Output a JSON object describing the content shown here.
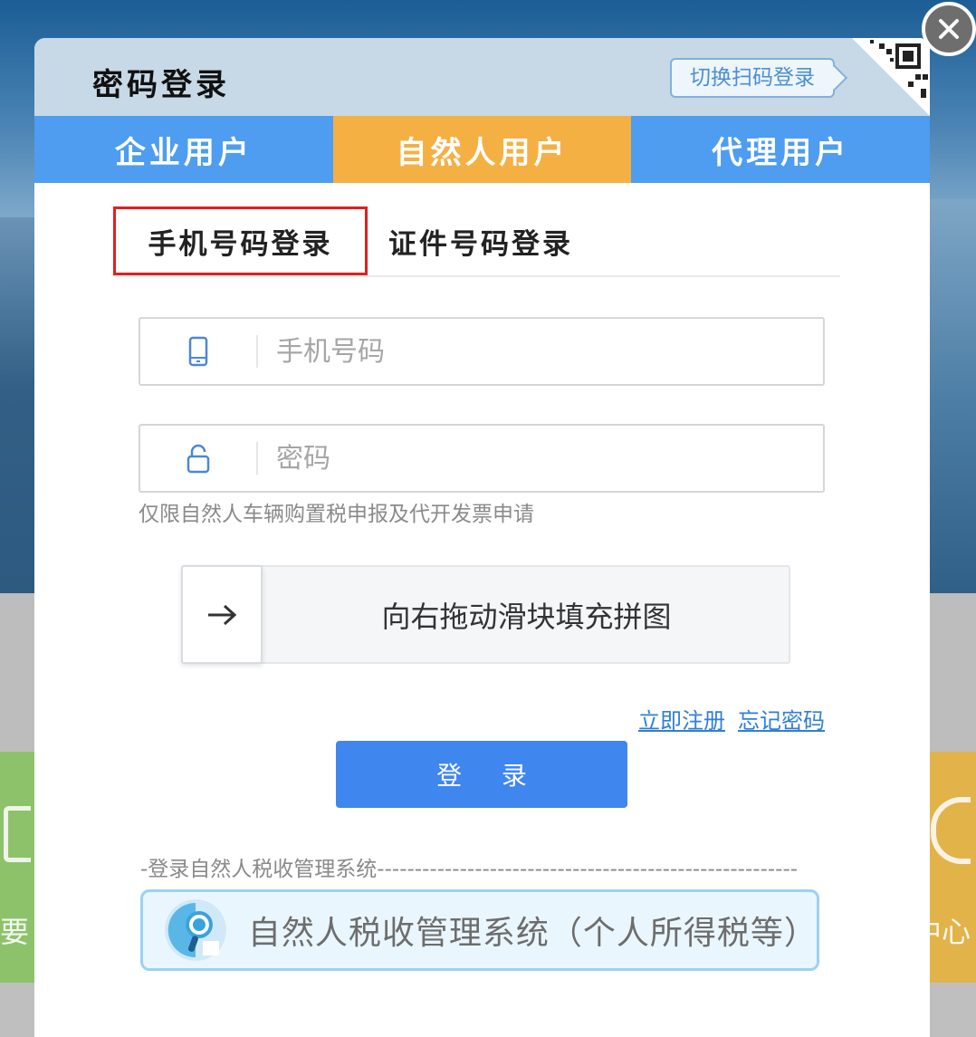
{
  "dialog": {
    "title": "密码登录",
    "switch_qr_label": "切换扫码登录"
  },
  "user_tabs": [
    {
      "label": "企业用户",
      "active": false
    },
    {
      "label": "自然人用户",
      "active": true
    },
    {
      "label": "代理用户",
      "active": false
    }
  ],
  "login_tabs": [
    {
      "label": "手机号码登录",
      "active": true
    },
    {
      "label": "证件号码登录",
      "active": false
    }
  ],
  "phone_field": {
    "placeholder": "手机号码",
    "value": "",
    "icon": "mobile-phone-icon"
  },
  "password_field": {
    "placeholder": "密码",
    "value": "",
    "icon": "lock-icon"
  },
  "note": "仅限自然人车辆购置税申报及代开发票申请",
  "slider": {
    "text": "向右拖动滑块填充拼图",
    "icon": "arrow-right-icon"
  },
  "links": {
    "register": "立即注册",
    "forgot": "忘记密码"
  },
  "login_button": "登 录",
  "divider_label": "-登录自然人税收管理系统--------------------------------------------------------",
  "system_button": {
    "label": "自然人税收管理系统（个人所得税等）",
    "icon": "tax-system-logo-icon"
  },
  "background": {
    "left_char": "要",
    "right_char": "中心"
  },
  "colors": {
    "tab_blue": "#4e9df0",
    "tab_orange": "#f5b043",
    "login_blue": "#3f86ef",
    "link_blue": "#2f7fd8",
    "highlight_red": "#e02020"
  }
}
